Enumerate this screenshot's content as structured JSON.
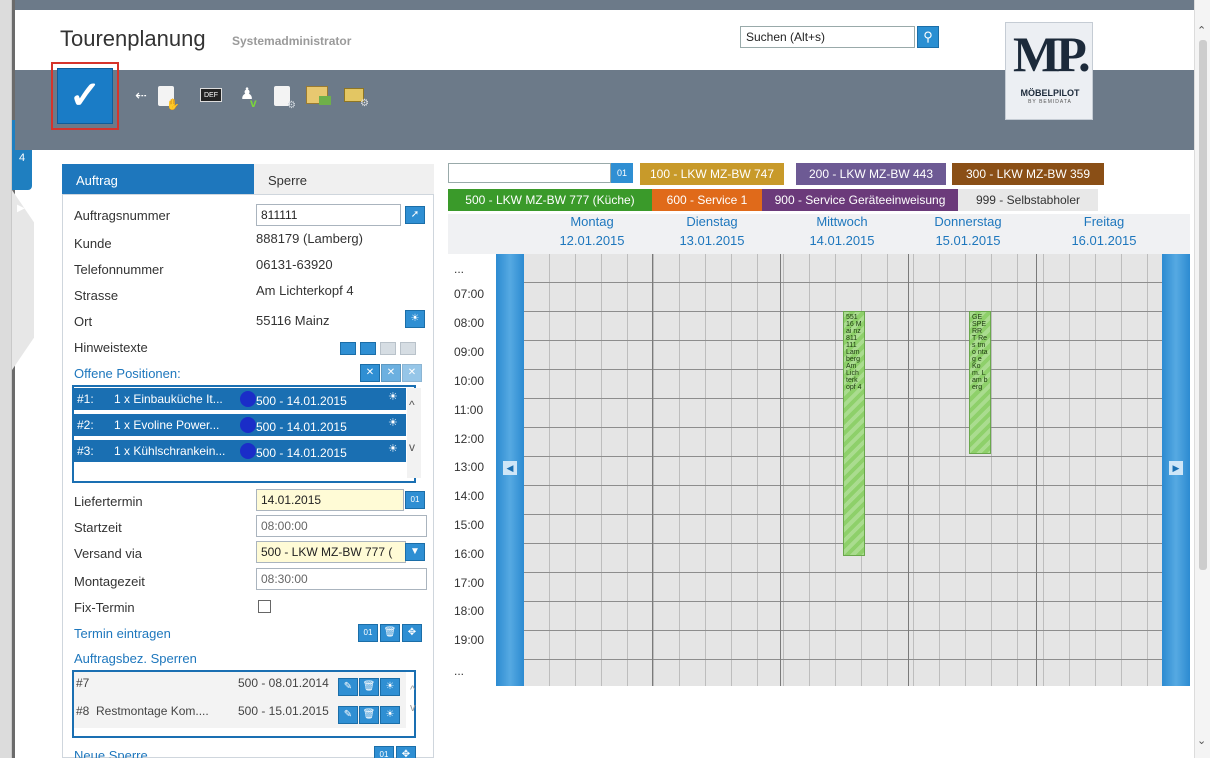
{
  "window": {
    "title": "Tourenplanung",
    "user": "Systemadministrator"
  },
  "search": {
    "value": "Suchen (Alt+s)"
  },
  "logo": {
    "text": "MP.",
    "name": "MÖBELPILOT",
    "sub": "BY BEMIDATA"
  },
  "rail": {
    "tab_label": "W\n4"
  },
  "tabs": {
    "auftrag": "Auftrag",
    "sperre": "Sperre"
  },
  "form": {
    "auftragsnummer_label": "Auftragsnummer",
    "auftragsnummer_value": "811111",
    "kunde_label": "Kunde",
    "kunde_value": "888179 (Lamberg)",
    "telefon_label": "Telefonnummer",
    "telefon_value": "06131-63920",
    "strasse_label": "Strasse",
    "strasse_value": "Am Lichterkopf 4",
    "ort_label": "Ort",
    "ort_value": "55116 Mainz",
    "hinweis_label": "Hinweistexte",
    "offene_label": "Offene Positionen:",
    "positions": [
      {
        "num": "#1:",
        "text": "1 x Einbauküche It...",
        "date": "500 - 14.01.2015"
      },
      {
        "num": "#2:",
        "text": "1 x Evoline Power...",
        "date": "500 - 14.01.2015"
      },
      {
        "num": "#3:",
        "text": "1 x Kühlschrankein...",
        "date": "500 - 14.01.2015"
      }
    ],
    "liefertermin_label": "Liefertermin",
    "liefertermin_value": "14.01.2015",
    "startzeit_label": "Startzeit",
    "startzeit_value": "08:00:00",
    "versand_label": "Versand via",
    "versand_value": "500 - LKW MZ-BW 777 (",
    "montagezeit_label": "Montagezeit",
    "montagezeit_value": "08:30:00",
    "fix_label": "Fix-Termin",
    "termin_label": "Termin eintragen",
    "sperren_label": "Auftragsbez. Sperren",
    "sperren": [
      {
        "num": "#7",
        "text": "",
        "date": "500 - 08.01.2014"
      },
      {
        "num": "#8",
        "text": "Restmontage Kom....",
        "date": "500 - 15.01.2015"
      }
    ],
    "neue_sperre_label": "Neue Sperre"
  },
  "resources": [
    {
      "label": "100 - LKW MZ-BW 747",
      "color": "#c89a2a"
    },
    {
      "label": "200 - LKW MZ-BW 443",
      "color": "#6d5a94"
    },
    {
      "label": "300 - LKW MZ-BW 359",
      "color": "#8a4f16"
    },
    {
      "label": "500 - LKW MZ-BW 777 (Küche)",
      "color": "#3a9a2a"
    },
    {
      "label": "600 - Service 1",
      "color": "#e06a1a"
    },
    {
      "label": "900 - Service Geräteeinweisung",
      "color": "#6b3a7a"
    },
    {
      "label": "999 - Selbstabholer",
      "color": "#e8e8e8"
    }
  ],
  "calendar": {
    "days": [
      {
        "name": "Montag",
        "date": "12.01.2015"
      },
      {
        "name": "Dienstag",
        "date": "13.01.2015"
      },
      {
        "name": "Mittwoch",
        "date": "14.01.2015"
      },
      {
        "name": "Donnerstag",
        "date": "15.01.2015"
      },
      {
        "name": "Freitag",
        "date": "16.01.2015"
      }
    ],
    "times": [
      "...",
      "07:00",
      "08:00",
      "09:00",
      "10:00",
      "11:00",
      "12:00",
      "13:00",
      "14:00",
      "15:00",
      "16:00",
      "17:00",
      "18:00",
      "19:00",
      "..."
    ],
    "appointments": [
      {
        "day": "Mittwoch",
        "text": "551 16 Mai nz 811 111 Lam berg Am Lich terk opf 4",
        "color": "#8ed06a"
      },
      {
        "day": "Donnerstag",
        "text": "GE SPE RR T Res tmo ntag e Ko m. Lam berg",
        "color": "#8ed06a"
      }
    ]
  }
}
